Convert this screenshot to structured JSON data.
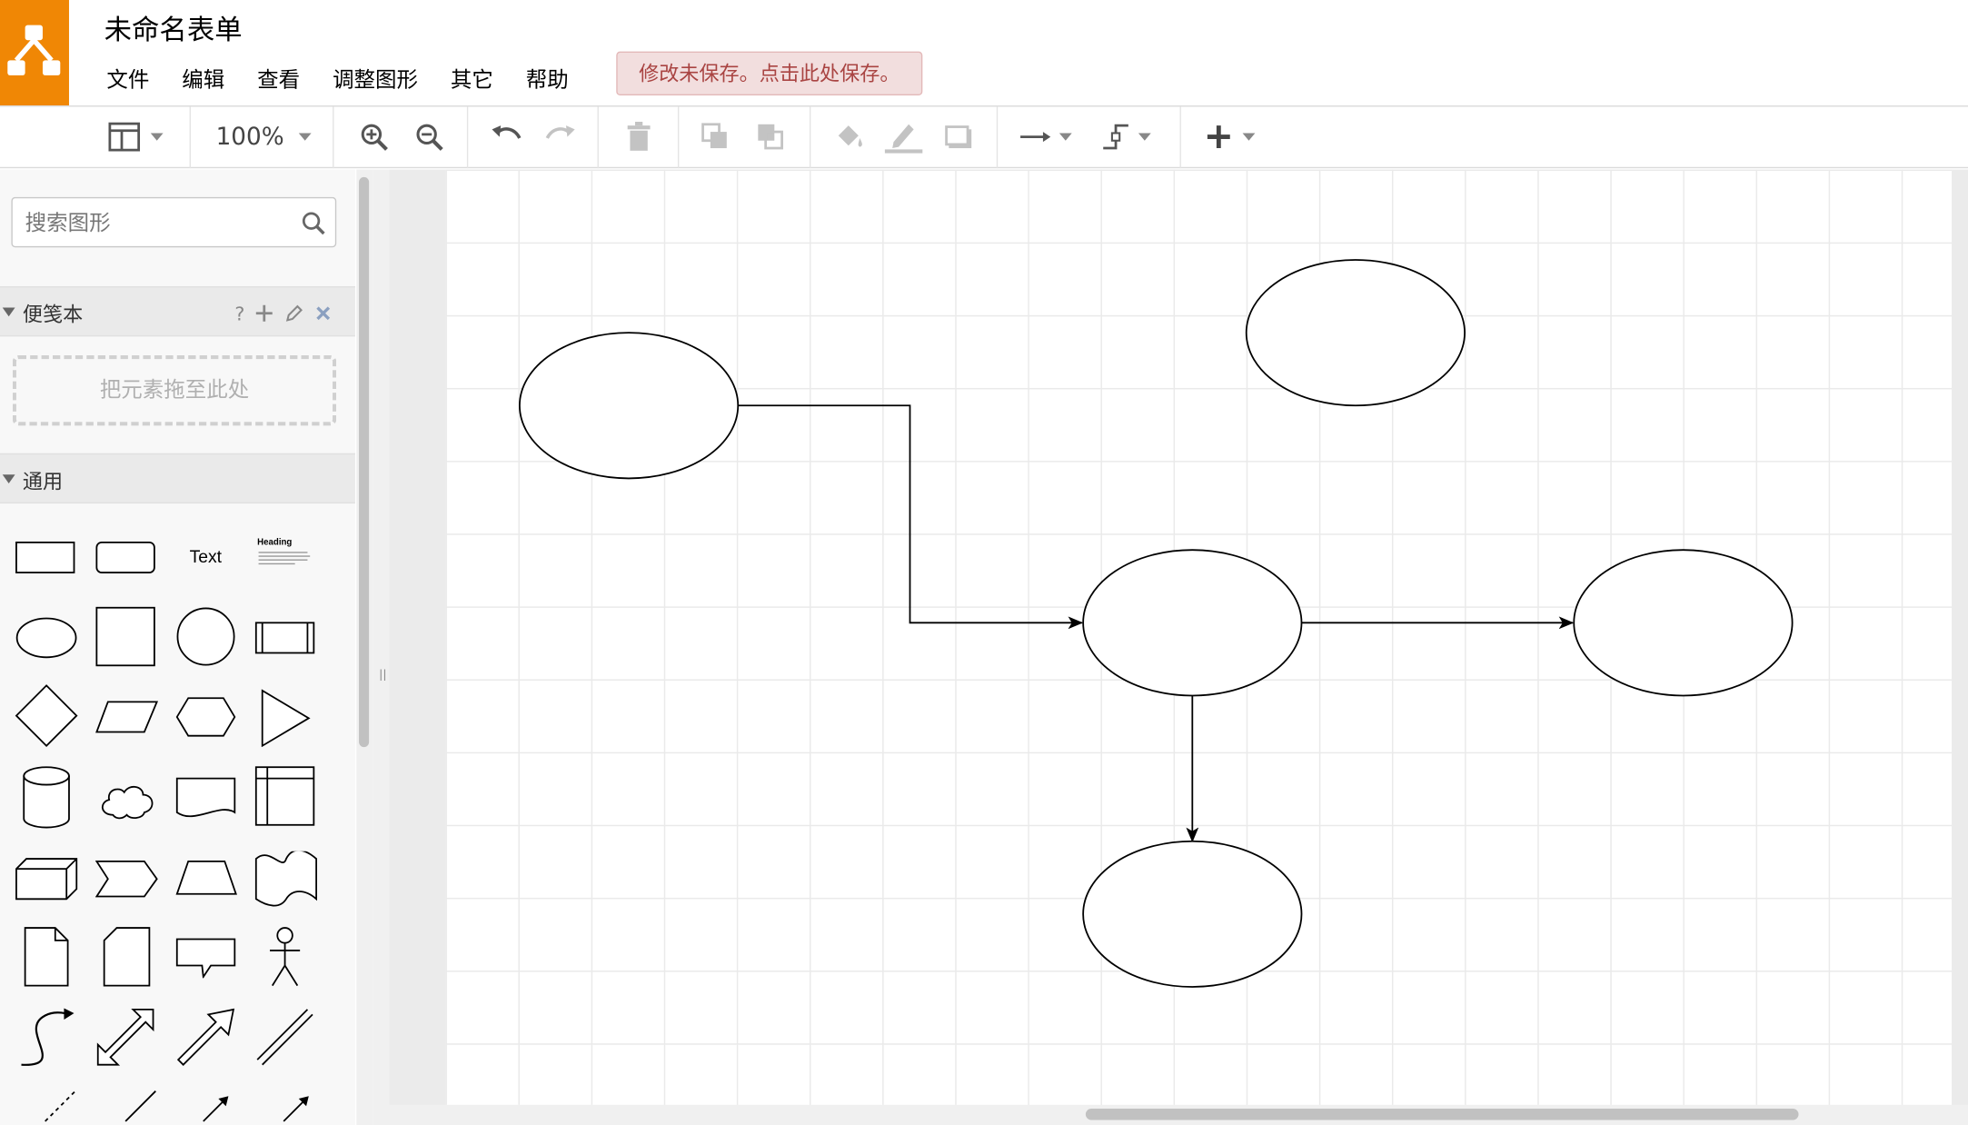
{
  "app": {
    "title": "未命名表单",
    "logo_icon": "drawio-logo-icon",
    "accent_color": "#f08705"
  },
  "menu": {
    "items": [
      "文件",
      "编辑",
      "查看",
      "调整图形",
      "其它",
      "帮助"
    ],
    "save_warning": "修改未保存。点击此处保存。"
  },
  "toolbar": {
    "zoom": "100%",
    "tools": [
      "format-panel-icon",
      "zoom-in-icon",
      "zoom-out-icon",
      "undo-icon",
      "redo-icon",
      "delete-icon",
      "to-front-icon",
      "to-back-icon",
      "fill-color-icon",
      "line-color-icon",
      "shadow-icon",
      "connection-icon",
      "waypoints-icon",
      "insert-icon"
    ]
  },
  "sidebar": {
    "search_placeholder": "搜索图形",
    "scratchpad": {
      "title": "便笺本",
      "help": "?",
      "drop_text": "把元素拖至此处"
    },
    "general": {
      "title": "通用",
      "text_shape": "Text",
      "heading_shape": "Heading"
    }
  },
  "diagram": {
    "shapes": [
      "ellipse",
      "ellipse",
      "ellipse",
      "ellipse",
      "ellipse"
    ],
    "connectors": [
      "orthogonal-arrow",
      "arrow",
      "arrow"
    ]
  }
}
